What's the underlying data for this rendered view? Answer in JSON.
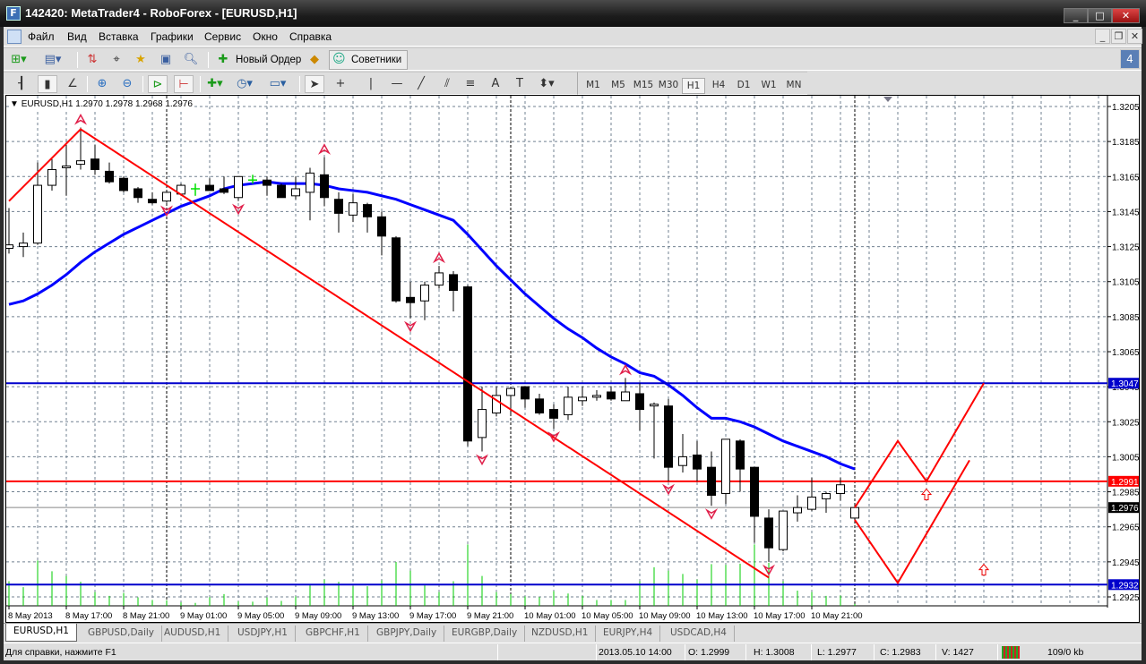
{
  "window": {
    "title": "142420: MetaTrader4 - RoboForex - [EURUSD,H1]",
    "app_icon": "mt4-icon"
  },
  "menu": [
    "Файл",
    "Вид",
    "Вставка",
    "Графики",
    "Сервис",
    "Окно",
    "Справка"
  ],
  "toolbar": {
    "new_order": "Новый Ордер",
    "experts": "Советники",
    "notifications": "4",
    "timeframes": [
      "M1",
      "M5",
      "M15",
      "M30",
      "H1",
      "H4",
      "D1",
      "W1",
      "MN"
    ],
    "active_timeframe": "H1"
  },
  "chart_header": "EURUSD,H1  1.2970 1.2978 1.2968 1.2976",
  "tabs": [
    "EURUSD,H1",
    "GBPUSD,Daily",
    "AUDUSD,H1",
    "USDJPY,H1",
    "GBPCHF,H1",
    "GBPJPY,Daily",
    "EURGBP,Daily",
    "NZDUSD,H1",
    "EURJPY,H4",
    "USDCAD,H4"
  ],
  "status": {
    "help": "Для справки, нажмите F1",
    "time": "2013.05.10 14:00",
    "open": "O: 1.2999",
    "high": "H: 1.3008",
    "low": "L: 1.2977",
    "close": "C: 1.2983",
    "volume": "V: 1427",
    "traffic": "109/0 kb"
  },
  "chart_data": {
    "type": "candlestick",
    "symbol": "EURUSD",
    "timeframe": "H1",
    "ylim": [
      1.2919,
      1.3211
    ],
    "y_ticks": [
      "1.3205",
      "1.3185",
      "1.3165",
      "1.3145",
      "1.3125",
      "1.3105",
      "1.3085",
      "1.3065",
      "1.3045",
      "1.3025",
      "1.3005",
      "1.2985",
      "1.2965",
      "1.2945",
      "1.2925"
    ],
    "x_labels": [
      [
        0,
        "8 May 2013"
      ],
      [
        4,
        "8 May 17:00"
      ],
      [
        8,
        "8 May 21:00"
      ],
      [
        12,
        "9 May 01:00"
      ],
      [
        16,
        "9 May 05:00"
      ],
      [
        20,
        "9 May 09:00"
      ],
      [
        24,
        "9 May 13:00"
      ],
      [
        28,
        "9 May 17:00"
      ],
      [
        32,
        "9 May 21:00"
      ],
      [
        36,
        "10 May 01:00"
      ],
      [
        40,
        "10 May 05:00"
      ],
      [
        44,
        "10 May 09:00"
      ],
      [
        48,
        "10 May 13:00"
      ],
      [
        52,
        "10 May 17:00"
      ],
      [
        56,
        "10 May 21:00"
      ]
    ],
    "bars_ohlcv": [
      [
        1.3124,
        1.3147,
        1.3121,
        1.3126,
        840
      ],
      [
        1.3125,
        1.3133,
        1.3119,
        1.3127,
        640
      ],
      [
        1.3127,
        1.3173,
        1.3126,
        1.316,
        1550
      ],
      [
        1.316,
        1.3175,
        1.3157,
        1.3169,
        1180
      ],
      [
        1.317,
        1.3183,
        1.3154,
        1.3171,
        1020
      ],
      [
        1.3172,
        1.3193,
        1.3169,
        1.3174,
        820
      ],
      [
        1.3175,
        1.3183,
        1.3166,
        1.3169,
        470
      ],
      [
        1.3168,
        1.3173,
        1.3161,
        1.3162,
        340
      ],
      [
        1.3164,
        1.3165,
        1.3156,
        1.3157,
        440
      ],
      [
        1.3158,
        1.3159,
        1.315,
        1.3153,
        290
      ],
      [
        1.3152,
        1.3156,
        1.3149,
        1.315,
        200
      ],
      [
        1.3151,
        1.3157,
        1.315,
        1.3156,
        190
      ],
      [
        1.3155,
        1.3161,
        1.3154,
        1.316,
        120
      ],
      [
        1.3158,
        1.3161,
        1.3154,
        1.3158,
        100
      ],
      [
        1.316,
        1.3164,
        1.3157,
        1.3157,
        300
      ],
      [
        1.3158,
        1.3165,
        1.3155,
        1.3156,
        400
      ],
      [
        1.3153,
        1.3165,
        1.3151,
        1.3165,
        150
      ],
      [
        1.3163,
        1.3166,
        1.3161,
        1.3163,
        140
      ],
      [
        1.3163,
        1.3165,
        1.3154,
        1.316,
        290
      ],
      [
        1.316,
        1.3161,
        1.3153,
        1.3153,
        170
      ],
      [
        1.3154,
        1.3165,
        1.3152,
        1.3158,
        320
      ],
      [
        1.3156,
        1.317,
        1.314,
        1.3167,
        700
      ],
      [
        1.3166,
        1.3176,
        1.3148,
        1.3153,
        900
      ],
      [
        1.3152,
        1.3156,
        1.3133,
        1.3144,
        820
      ],
      [
        1.3143,
        1.3155,
        1.3139,
        1.315,
        670
      ],
      [
        1.3149,
        1.315,
        1.3133,
        1.3142,
        670
      ],
      [
        1.3142,
        1.3145,
        1.312,
        1.3131,
        870
      ],
      [
        1.313,
        1.3131,
        1.3093,
        1.3094,
        1500
      ],
      [
        1.3096,
        1.3105,
        1.3084,
        1.3093,
        1200
      ],
      [
        1.3094,
        1.3105,
        1.3083,
        1.3103,
        700
      ],
      [
        1.3103,
        1.3114,
        1.3101,
        1.311,
        470
      ],
      [
        1.3109,
        1.3111,
        1.3088,
        1.31,
        840
      ],
      [
        1.3102,
        1.3103,
        1.3011,
        1.3014,
        2100
      ],
      [
        1.3016,
        1.3045,
        1.3008,
        1.3032,
        1020
      ],
      [
        1.303,
        1.3045,
        1.3028,
        1.304,
        470
      ],
      [
        1.304,
        1.3045,
        1.3029,
        1.3044,
        400
      ],
      [
        1.3045,
        1.3045,
        1.3033,
        1.3038,
        320
      ],
      [
        1.3038,
        1.3041,
        1.3029,
        1.303,
        300
      ],
      [
        1.3032,
        1.3035,
        1.3021,
        1.3027,
        500
      ],
      [
        1.3029,
        1.3045,
        1.3026,
        1.3039,
        420
      ],
      [
        1.3037,
        1.3045,
        1.3034,
        1.3039,
        340
      ],
      [
        1.3039,
        1.3043,
        1.3037,
        1.304,
        200
      ],
      [
        1.3042,
        1.3045,
        1.3037,
        1.3038,
        200
      ],
      [
        1.3037,
        1.305,
        1.3037,
        1.3042,
        200
      ],
      [
        1.3041,
        1.3047,
        1.302,
        1.3032,
        840
      ],
      [
        1.3034,
        1.3036,
        1.3004,
        1.3035,
        1320
      ],
      [
        1.3034,
        1.3038,
        1.2991,
        1.2999,
        1200
      ],
      [
        1.3,
        1.3018,
        1.2996,
        1.3005,
        1090
      ],
      [
        1.3006,
        1.3014,
        1.2991,
        1.2998,
        900
      ],
      [
        1.2999,
        1.3008,
        1.2977,
        1.2983,
        1427
      ],
      [
        1.2984,
        1.3015,
        1.2978,
        1.3015,
        1400
      ],
      [
        1.3014,
        1.3015,
        1.2985,
        1.2998,
        1440
      ],
      [
        1.2999,
        1.2999,
        1.2956,
        1.2971,
        2100
      ],
      [
        1.297,
        1.2975,
        1.2945,
        1.2953,
        1470
      ],
      [
        1.2952,
        1.2974,
        1.2951,
        1.2974,
        840
      ],
      [
        1.2973,
        1.2983,
        1.2968,
        1.2976,
        520
      ],
      [
        1.2975,
        1.2993,
        1.2974,
        1.2982,
        470
      ],
      [
        1.2981,
        1.2985,
        1.2973,
        1.2984,
        340
      ],
      [
        1.2984,
        1.2993,
        1.298,
        1.2989,
        350
      ],
      [
        1.297,
        1.2978,
        1.2968,
        1.2976,
        70
      ]
    ],
    "moving_average": [
      1.3092,
      1.3094,
      1.3098,
      1.3103,
      1.3109,
      1.3116,
      1.3122,
      1.3127,
      1.3132,
      1.3136,
      1.314,
      1.3144,
      1.3148,
      1.3151,
      1.3154,
      1.3158,
      1.316,
      1.3161,
      1.3162,
      1.3161,
      1.3161,
      1.3161,
      1.316,
      1.3158,
      1.3157,
      1.3156,
      1.3154,
      1.3152,
      1.3149,
      1.3146,
      1.3143,
      1.314,
      1.3132,
      1.3123,
      1.3114,
      1.3106,
      1.3098,
      1.3091,
      1.3084,
      1.3078,
      1.3073,
      1.3067,
      1.3062,
      1.3058,
      1.3053,
      1.3051,
      1.3046,
      1.304,
      1.3033,
      1.3027,
      1.3027,
      1.3025,
      1.3022,
      1.3018,
      1.3014,
      1.3011,
      1.3008,
      1.3005,
      1.3001,
      1.2998
    ],
    "hlines": [
      {
        "price": 1.3047,
        "label": "1.3047",
        "color": "#0000cc"
      },
      {
        "price": 1.2991,
        "label": "1.2991",
        "color": "#ff0000"
      },
      {
        "price": 1.2932,
        "label": "1.2932",
        "color": "#0000cc"
      }
    ],
    "current_price": {
      "price": 1.2976,
      "label": "1.2976"
    },
    "polylines": [
      {
        "color": "#ff0000",
        "points": [
          [
            0,
            1.3151
          ],
          [
            5,
            1.3192
          ],
          [
            53,
            1.2936
          ]
        ]
      },
      {
        "color": "#ff0000",
        "points": [
          [
            59,
            1.2976
          ],
          [
            62,
            1.3014
          ],
          [
            64,
            1.2991
          ],
          [
            68,
            1.3047
          ]
        ]
      },
      {
        "color": "#ff0000",
        "points": [
          [
            59,
            1.2969
          ],
          [
            62,
            1.2933
          ],
          [
            67,
            1.3003
          ]
        ]
      }
    ],
    "fractals_up": [
      5,
      22,
      30,
      43
    ],
    "fractals_down": [
      11,
      16,
      28,
      33,
      38,
      46,
      49,
      53
    ],
    "future_arrows_up": [
      [
        64,
        1.2983
      ],
      [
        68,
        1.294
      ]
    ],
    "period_separators": [
      11,
      35,
      59
    ],
    "colors": {
      "bull": "#ffffff",
      "bear": "#000000",
      "doji": "#00e000",
      "ma": "#0000ff",
      "volume": "#00cc00",
      "grid": "#708090",
      "fractal": "#e0204a"
    }
  }
}
